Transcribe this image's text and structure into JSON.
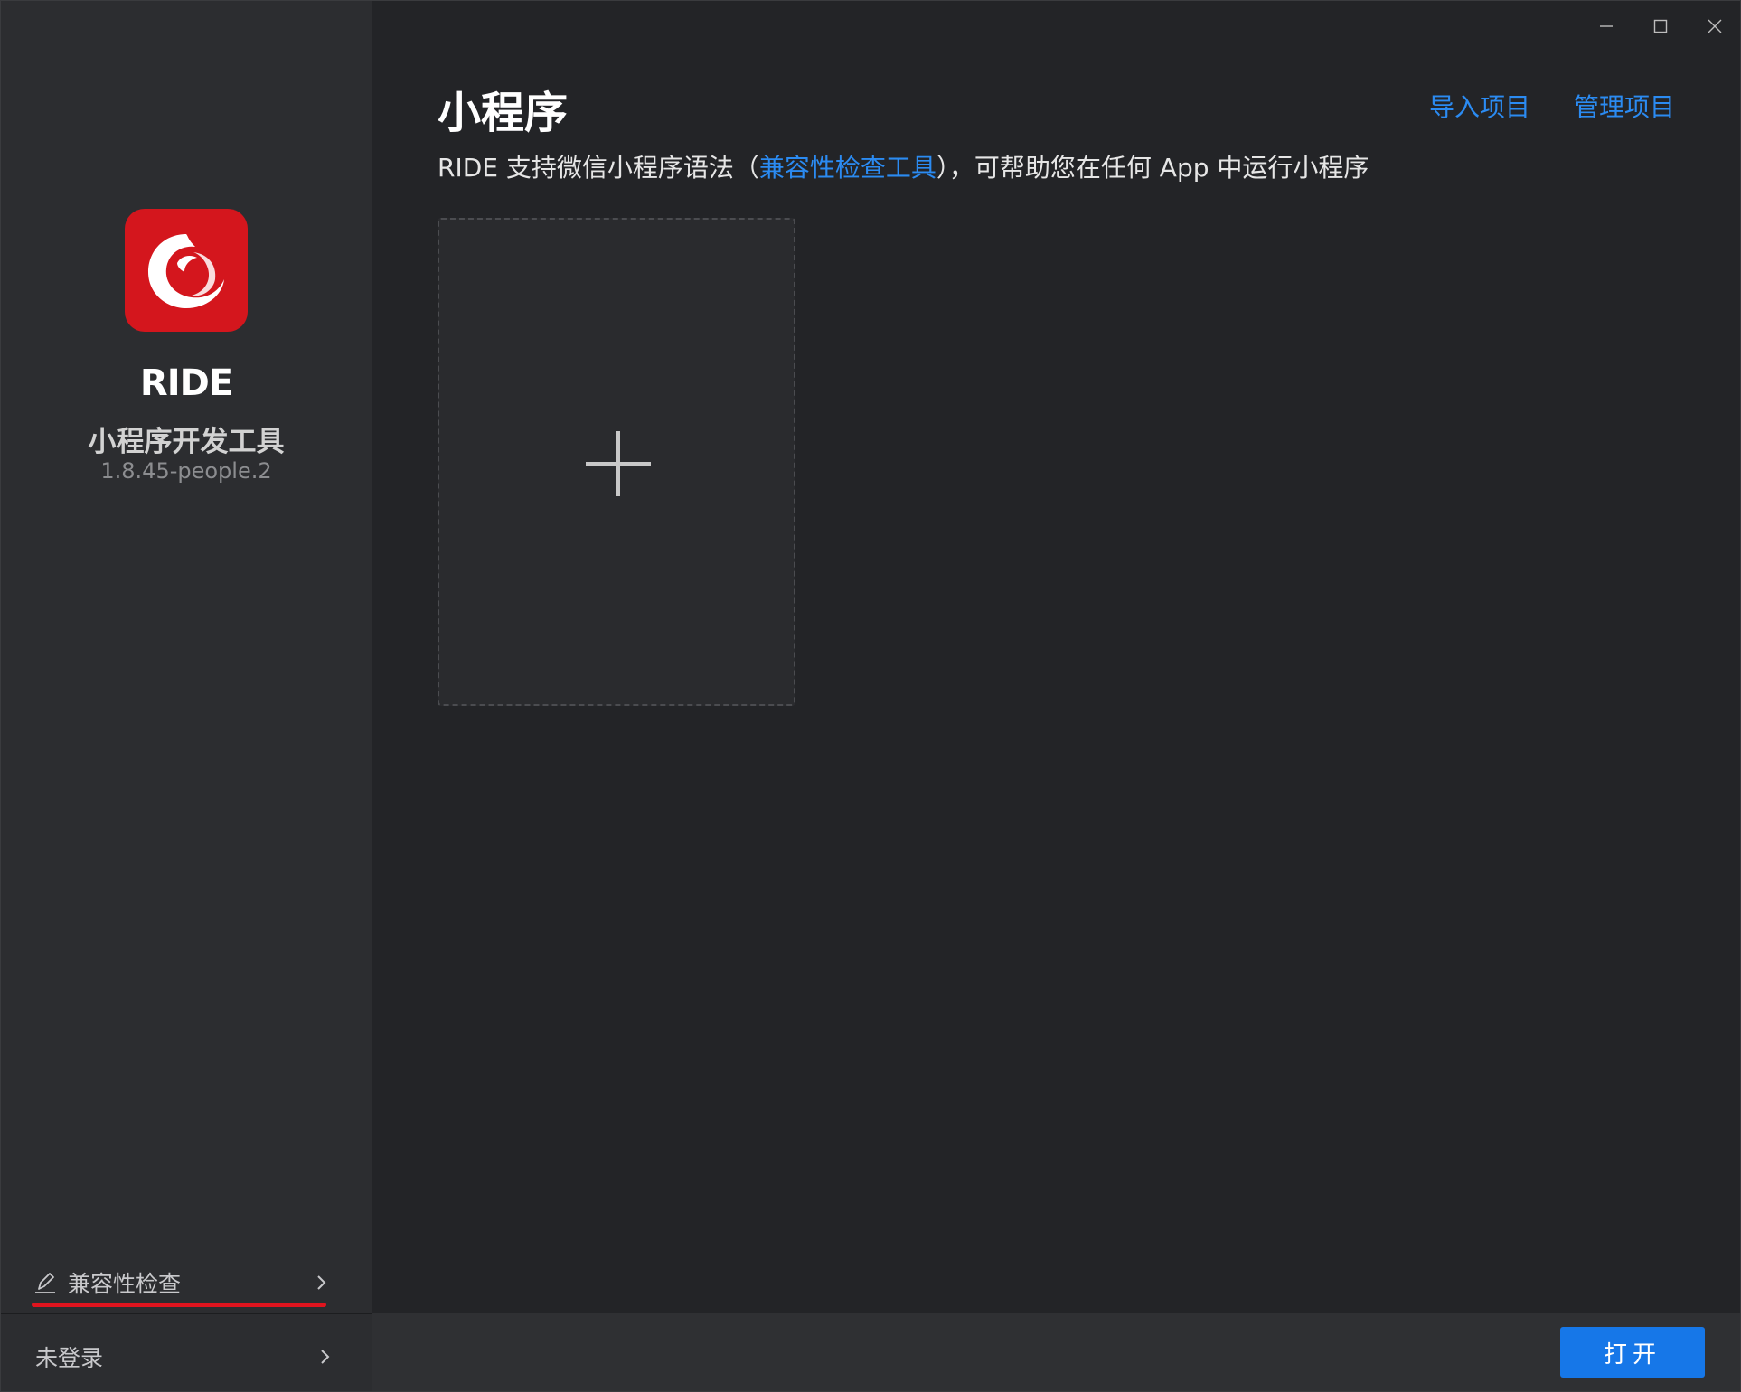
{
  "sidebar": {
    "app_name": "RIDE",
    "app_subtitle": "小程序开发工具",
    "version": "1.8.45-people.2",
    "compat_link": "兼容性检查",
    "login_link": "未登录"
  },
  "header": {
    "title": "小程序",
    "import_link": "导入项目",
    "manage_link": "管理项目"
  },
  "description": {
    "prefix": "RIDE 支持微信小程序语法（",
    "link": "兼容性检查工具",
    "suffix": "），可帮助您在任何 App 中运行小程序"
  },
  "footer": {
    "open_button": "打开"
  },
  "colors": {
    "accent": "#1677e8",
    "link": "#2b8bf2",
    "logo_red": "#d4161d",
    "underline_red": "#e0141e"
  },
  "icons": {
    "logo": "ride-logo-icon",
    "add": "plus-icon",
    "compat": "pen-icon",
    "chevron": "chevron-right-icon",
    "minimize": "minimize-icon",
    "maximize": "maximize-icon",
    "close": "close-icon"
  }
}
